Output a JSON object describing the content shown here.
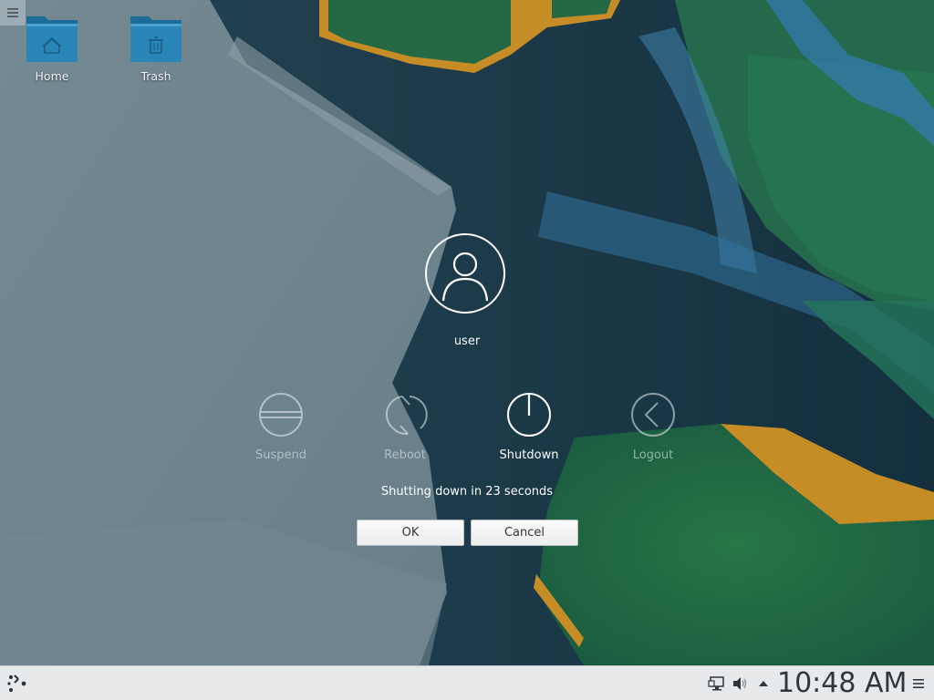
{
  "desktop": {
    "icons": [
      {
        "label": "Home",
        "icon": "home-folder-icon"
      },
      {
        "label": "Trash",
        "icon": "trash-folder-icon"
      }
    ],
    "toolbox_icon": "hamburger-menu-icon"
  },
  "logout": {
    "username": "user",
    "actions": [
      {
        "label": "Suspend",
        "icon": "suspend-icon",
        "active": false
      },
      {
        "label": "Reboot",
        "icon": "reboot-icon",
        "active": false
      },
      {
        "label": "Shutdown",
        "icon": "power-icon",
        "active": true
      },
      {
        "label": "Logout",
        "icon": "logout-arrow-icon",
        "active": false
      }
    ],
    "countdown": "Shutting down in 23 seconds",
    "ok_label": "OK",
    "cancel_label": "Cancel"
  },
  "panel": {
    "launcher_icon": "plasma-launcher-icon",
    "tray_icons": [
      "network-icon",
      "volume-icon",
      "expand-tray-arrow-icon"
    ],
    "clock": "10:48 AM",
    "menu_icon": "panel-options-icon"
  },
  "colors": {
    "panel_bg": "#e7e9eb",
    "folder_blue": "#1d6b97",
    "button_text": "#31363b"
  }
}
